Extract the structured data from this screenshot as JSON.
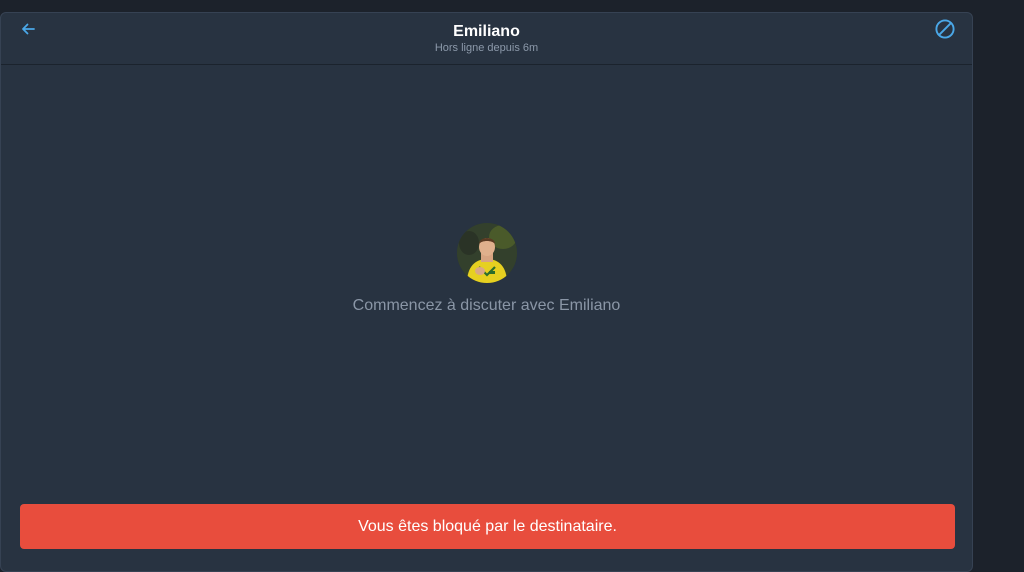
{
  "header": {
    "contact_name": "Emiliano",
    "status": "Hors ligne depuis 6m",
    "back_icon": "arrow-left-icon",
    "block_icon": "block-icon"
  },
  "empty_state": {
    "avatar": "contact-avatar-photo",
    "message": "Commencez à discuter avec Emiliano"
  },
  "banner": {
    "text": "Vous êtes bloqué par le destinataire."
  },
  "colors": {
    "background": "#1c222b",
    "panel": "#283341",
    "accent": "#4aa8e8",
    "banner": "#e84d3d"
  }
}
